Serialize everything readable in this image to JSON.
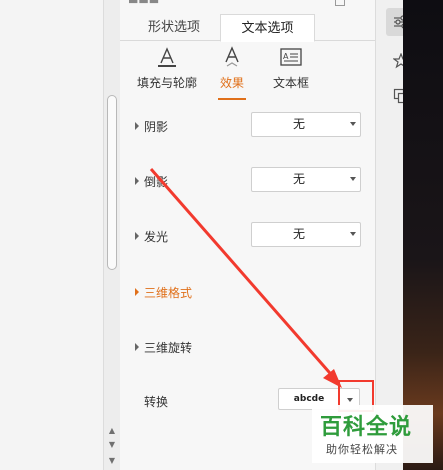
{
  "tabs": [
    {
      "label": "形状选项"
    },
    {
      "label": "文本选项"
    }
  ],
  "subtabs": [
    {
      "label": "填充与轮廓"
    },
    {
      "label": "效果"
    },
    {
      "label": "文本框"
    }
  ],
  "effects": {
    "shadow": {
      "label": "阴影",
      "value": "无"
    },
    "reflection": {
      "label": "倒影",
      "value": "无"
    },
    "glow": {
      "label": "发光",
      "value": "无"
    },
    "format3d": {
      "label": "三维格式"
    },
    "rotation3d": {
      "label": "三维旋转"
    },
    "transform": {
      "label": "转换",
      "value": "abcde"
    }
  },
  "watermark": {
    "title": "百科全说",
    "subtitle": "助你轻松解决"
  },
  "colors": {
    "accent": "#e0701a",
    "annotation_red": "#f23a2e",
    "brand_green": "#2f9c3c"
  }
}
